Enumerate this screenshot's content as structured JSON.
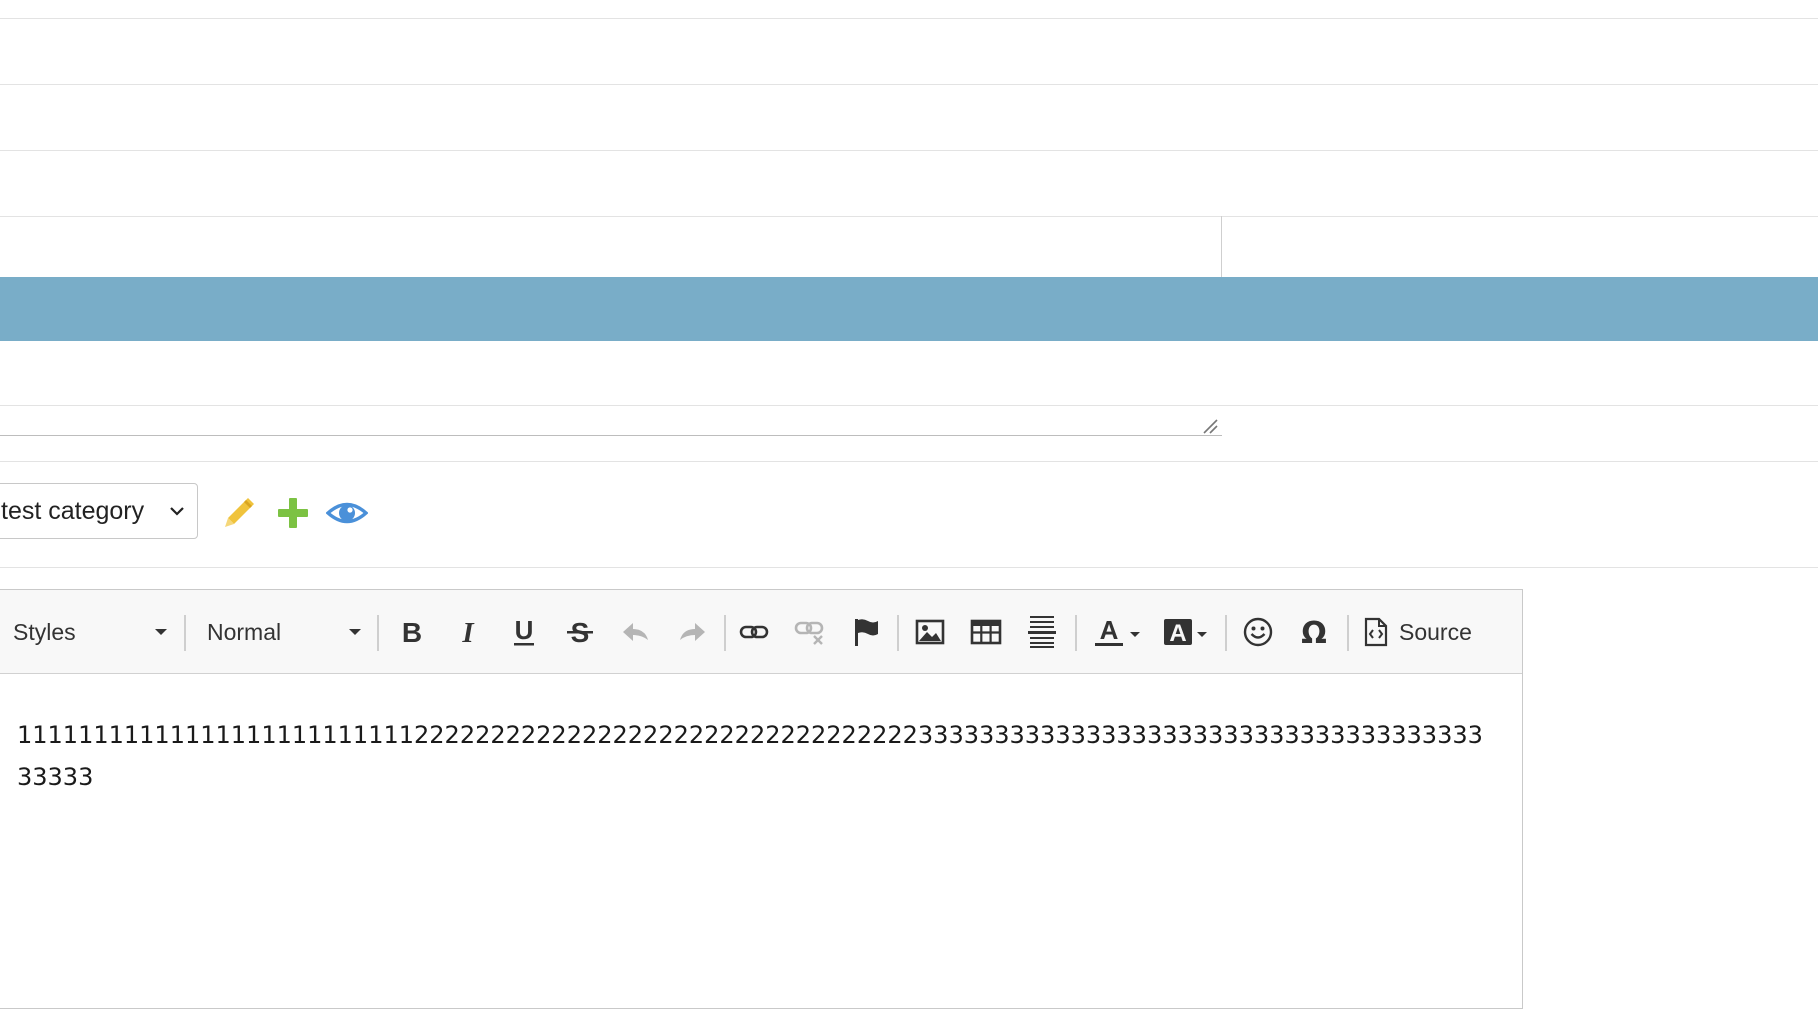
{
  "category": {
    "selected": "test category"
  },
  "actions": {
    "edit": "pencil-icon",
    "add": "plus-icon",
    "view": "eye-icon"
  },
  "toolbar": {
    "styles_label": "Styles",
    "format_label": "Normal",
    "source_label": "Source",
    "buttons": [
      "bold",
      "italic",
      "underline",
      "strikethrough",
      "undo",
      "redo",
      "link",
      "unlink",
      "anchor",
      "image",
      "table",
      "horizontal-rule",
      "text-color",
      "background-color",
      "smiley",
      "special-char",
      "source"
    ]
  },
  "editor": {
    "content": "11111111111111111111111111222222222222222222222222222222222333333333333333333333333333333333333333333"
  },
  "colors": {
    "band": "#79adc8",
    "pencil": "#f0c33c",
    "plus": "#7cc243",
    "eye": "#4a90d9"
  }
}
